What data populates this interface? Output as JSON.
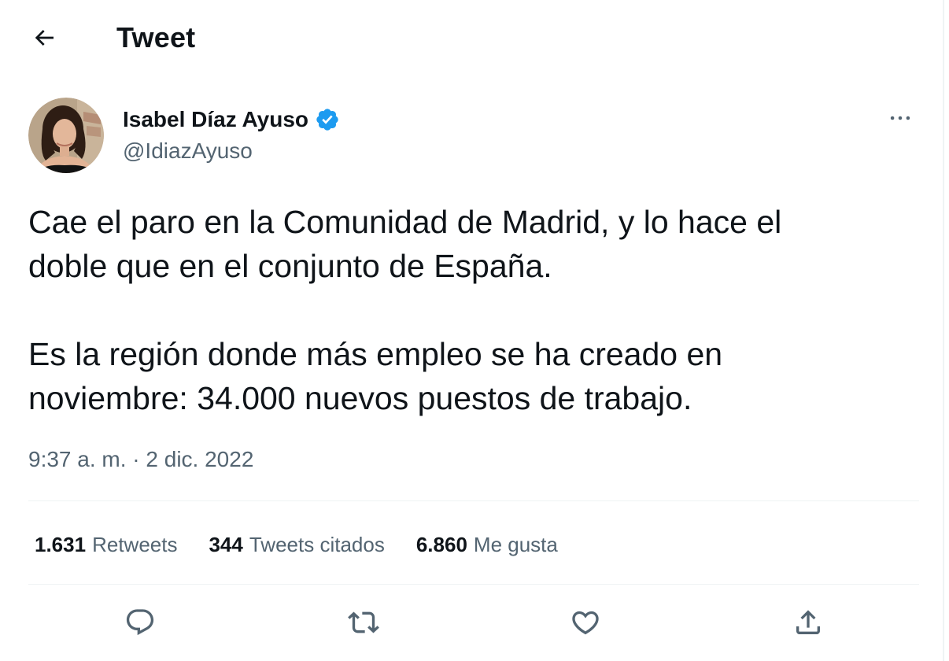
{
  "header": {
    "back_icon": "arrow-left-icon",
    "title": "Tweet"
  },
  "author": {
    "display_name": "Isabel Díaz Ayuso",
    "handle": "@IdiazAyuso",
    "verified_icon": "verified-badge-icon",
    "verified_color": "#1d9bf0"
  },
  "more_icon": "more-horizontal-icon",
  "tweet": {
    "paragraphs": [
      {
        "line1": "Cae el paro en la Comunidad de Madrid, y lo hace el",
        "line2": "doble que en el conjunto de España."
      },
      {
        "line1": "Es la región donde más empleo se ha creado en",
        "line2": "noviembre: 34.000 nuevos puestos de trabajo."
      }
    ],
    "timestamp": "9:37 a. m. · 2 dic. 2022"
  },
  "stats": [
    {
      "count": "1.631",
      "label": "Retweets"
    },
    {
      "count": "344",
      "label": "Tweets citados"
    },
    {
      "count": "6.860",
      "label": "Me gusta"
    }
  ],
  "actions": [
    {
      "icon": "reply-icon"
    },
    {
      "icon": "retweet-icon"
    },
    {
      "icon": "like-heart-icon"
    },
    {
      "icon": "share-icon"
    }
  ],
  "colors": {
    "text_primary": "#0f1419",
    "text_secondary": "#536471",
    "divider": "#eff3f4",
    "accent": "#1d9bf0"
  }
}
